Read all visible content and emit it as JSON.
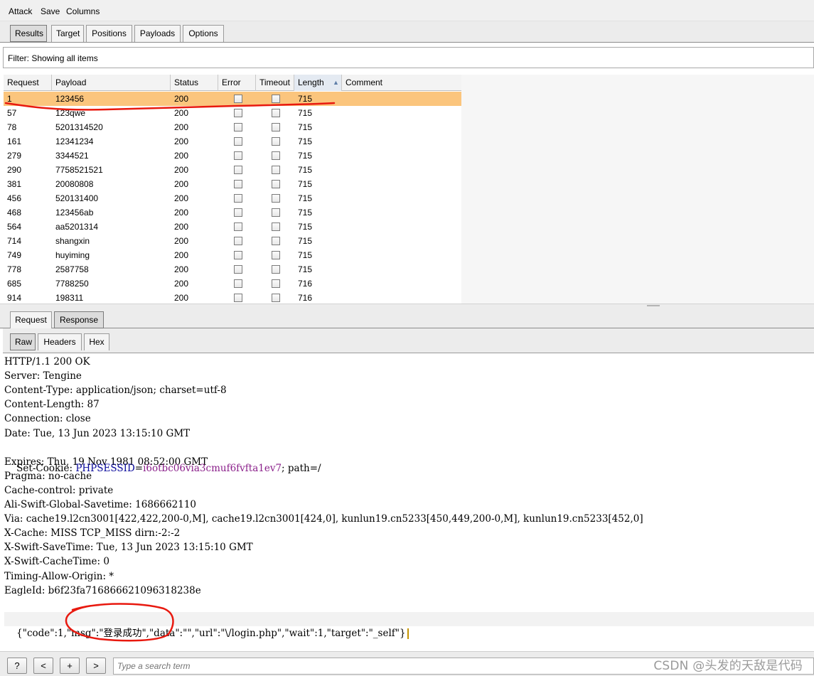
{
  "menu": [
    "Attack",
    "Save",
    "Columns"
  ],
  "main_tabs": [
    "Results",
    "Target",
    "Positions",
    "Payloads",
    "Options"
  ],
  "filter_text": "Filter: Showing all items",
  "table": {
    "columns": [
      "Request",
      "Payload",
      "Status",
      "Error",
      "Timeout",
      "Length",
      "Comment"
    ],
    "sort_indicator": "▲",
    "rows": [
      {
        "request": "1",
        "payload": "123456",
        "status": "200",
        "length": "715"
      },
      {
        "request": "57",
        "payload": "123qwe",
        "status": "200",
        "length": "715"
      },
      {
        "request": "78",
        "payload": "5201314520",
        "status": "200",
        "length": "715"
      },
      {
        "request": "161",
        "payload": "12341234",
        "status": "200",
        "length": "715"
      },
      {
        "request": "279",
        "payload": "3344521",
        "status": "200",
        "length": "715"
      },
      {
        "request": "290",
        "payload": "7758521521",
        "status": "200",
        "length": "715"
      },
      {
        "request": "381",
        "payload": "20080808",
        "status": "200",
        "length": "715"
      },
      {
        "request": "456",
        "payload": "520131400",
        "status": "200",
        "length": "715"
      },
      {
        "request": "468",
        "payload": "123456ab",
        "status": "200",
        "length": "715"
      },
      {
        "request": "564",
        "payload": "aa5201314",
        "status": "200",
        "length": "715"
      },
      {
        "request": "714",
        "payload": "shangxin",
        "status": "200",
        "length": "715"
      },
      {
        "request": "749",
        "payload": "huyiming",
        "status": "200",
        "length": "715"
      },
      {
        "request": "778",
        "payload": "2587758",
        "status": "200",
        "length": "715"
      },
      {
        "request": "685",
        "payload": "7788250",
        "status": "200",
        "length": "716"
      },
      {
        "request": "914",
        "payload": "198311",
        "status": "200",
        "length": "716"
      }
    ]
  },
  "message_tabs": [
    "Request",
    "Response"
  ],
  "view_tabs": [
    "Raw",
    "Headers",
    "Hex"
  ],
  "response_lines": [
    "HTTP/1.1 200 OK",
    "Server: Tengine",
    "Content-Type: application/json; charset=utf-8",
    "Content-Length: 87",
    "Connection: close",
    "Date: Tue, 13 Jun 2023 13:15:10 GMT",
    "",
    "Expires: Thu, 19 Nov 1981 08:52:00 GMT",
    "Pragma: no-cache",
    "Cache-control: private",
    "Ali-Swift-Global-Savetime: 1686662110",
    "Via: cache19.l2cn3001[422,422,200-0,M], cache19.l2cn3001[424,0], kunlun19.cn5233[450,449,200-0,M], kunlun19.cn5233[452,0]",
    "X-Cache: MISS TCP_MISS dirn:-2:-2",
    "X-Swift-SaveTime: Tue, 13 Jun 2023 13:15:10 GMT",
    "X-Swift-CacheTime: 0",
    "Timing-Allow-Origin: *",
    "EagleId: b6f23fa716866621096318238e"
  ],
  "set_cookie": {
    "prefix": "Set-Cookie: ",
    "key": "PHPSESSID",
    "eq": "=",
    "value": "i6otbc06via3cmuf6fvfta1ev7",
    "suffix": "; path=/"
  },
  "json_body": "{\"code\":1,\"msg\":\"登录成功\",\"data\":\"\",\"url\":\"\\/login.php\",\"wait\":1,\"target\":\"_self\"}",
  "bottom": {
    "help": "?",
    "prev": "<",
    "add": "+",
    "next": ">",
    "search_placeholder": "Type a search term"
  },
  "watermark": "CSDN @头发的天敌是代码",
  "colors": {
    "selected_row": "#fbc57d",
    "annotation": "#e8190f"
  }
}
